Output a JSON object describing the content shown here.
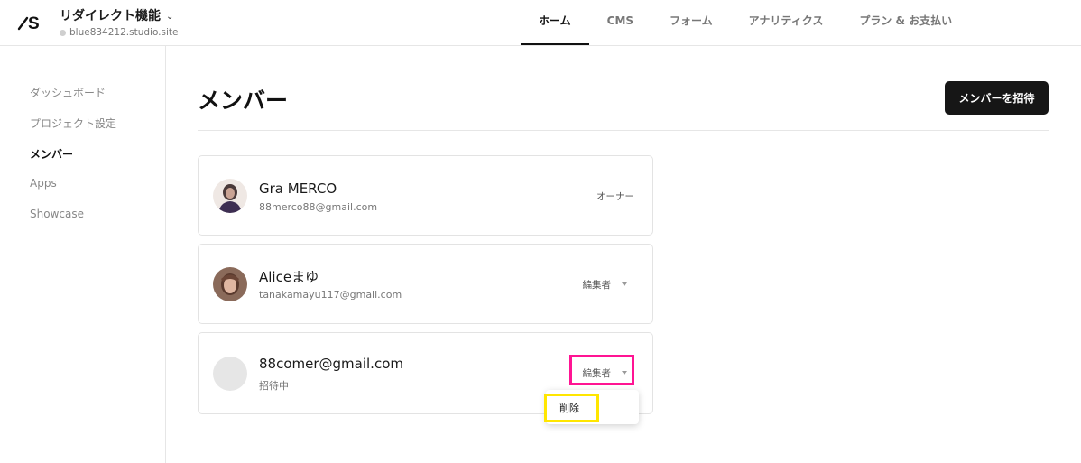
{
  "project": {
    "name": "リダイレクト機能",
    "url": "blue834212.studio.site"
  },
  "nav": {
    "items": [
      "ホーム",
      "CMS",
      "フォーム",
      "アナリティクス",
      "プラン & お支払い"
    ],
    "active": "ホーム"
  },
  "sidebar": {
    "items": [
      "ダッシュボード",
      "プロジェクト設定",
      "メンバー",
      "Apps",
      "Showcase"
    ],
    "active": "メンバー"
  },
  "main": {
    "title": "メンバー",
    "invite_button": "メンバーを招待"
  },
  "members": [
    {
      "name": "Gra MERCO",
      "sub": "88merco88@gmail.com",
      "role": "オーナー"
    },
    {
      "name": "Aliceまゆ",
      "sub": "tanakamayu117@gmail.com",
      "role": "編集者"
    },
    {
      "name": "88comer@gmail.com",
      "sub": "招待中",
      "role": "編集者"
    }
  ],
  "dropdown_menu": {
    "items": [
      "削除"
    ]
  },
  "colors": {
    "accent_dark": "#161616",
    "highlight_pink": "#ff1493",
    "highlight_yellow": "#ffe600"
  }
}
